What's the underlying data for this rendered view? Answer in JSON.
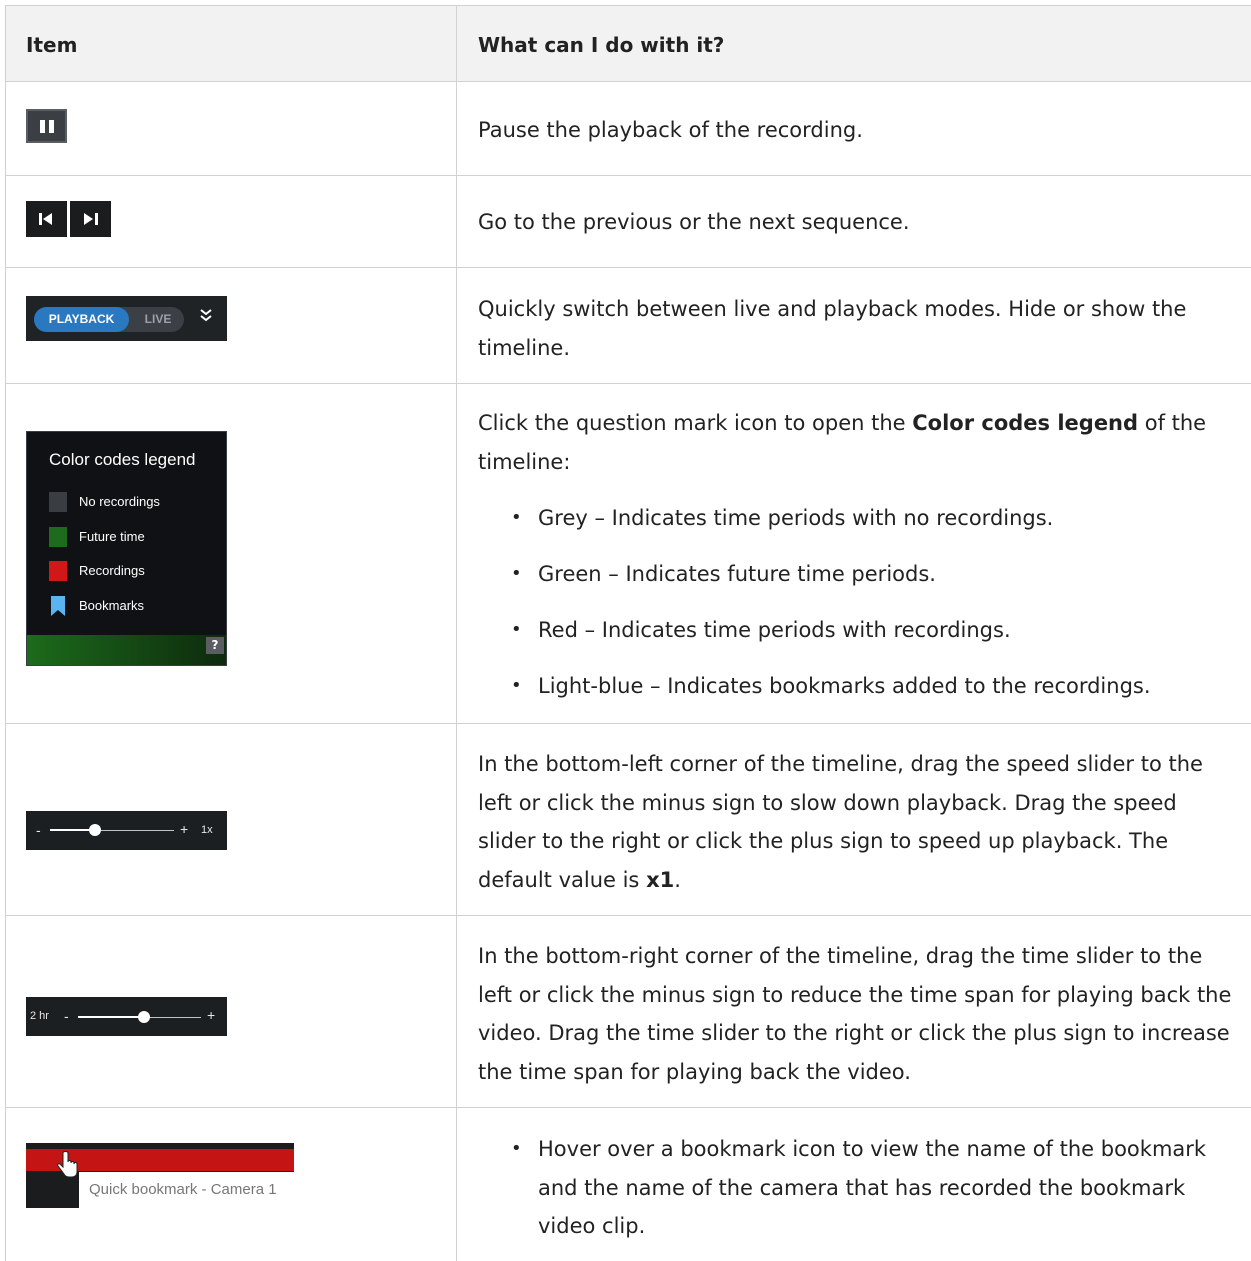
{
  "header": {
    "col1": "Item",
    "col2": "What can I do with it?"
  },
  "rows": [
    {
      "description": "Pause the playback of the recording."
    },
    {
      "description": "Go to the previous or the next sequence."
    },
    {
      "description": "Quickly switch between live and playback modes. Hide or show the timeline.",
      "thumb": {
        "playback_label": "PLAYBACK",
        "live_label": "LIVE",
        "chevron": "»"
      }
    },
    {
      "description_prefix": "Click the question mark icon to open the ",
      "description_bold": "Color codes legend",
      "description_suffix": " of the timeline:",
      "bullets": [
        "Grey – Indicates time periods with no recordings.",
        "Green – Indicates future time periods.",
        "Red – Indicates time periods with recordings.",
        "Light-blue – Indicates bookmarks added to the recordings."
      ],
      "legend": {
        "title": "Color codes legend",
        "items": [
          {
            "label": "No recordings",
            "color": "#3a3e42"
          },
          {
            "label": "Future time",
            "color": "#1e6b1e"
          },
          {
            "label": "Recordings",
            "color": "#d01818"
          },
          {
            "label": "Bookmarks",
            "color": "#5ab4f0"
          }
        ],
        "help": "?"
      }
    },
    {
      "description_prefix": "In the bottom-left corner of the timeline, drag the speed slider to the left or click the minus sign to slow down playback. Drag the speed slider to the right or click the plus sign to speed up playback. The default value is ",
      "description_bold": "x1",
      "description_suffix": ".",
      "thumb": {
        "minus": "-",
        "plus": "+",
        "speed": "1x",
        "level": 0.33
      }
    },
    {
      "description": "In the bottom-right corner of the timeline, drag the time slider to the left or click the minus sign to reduce the time span for playing back the video. Drag the time slider to the right or click the plus sign to increase the time span for playing back the video.",
      "thumb": {
        "span": "2 hr",
        "minus": "-",
        "plus": "+",
        "level": 0.55
      }
    },
    {
      "bullets": [
        "Hover over a bookmark icon to view the name of the bookmark and the name of the camera that has recorded the bookmark video clip."
      ],
      "thumb": {
        "tooltip": "Quick bookmark - Camera 1"
      }
    }
  ],
  "colors": {
    "header_bg": "#f2f2f2",
    "border": "#d2d2d2",
    "accent": "#2a78c0"
  }
}
